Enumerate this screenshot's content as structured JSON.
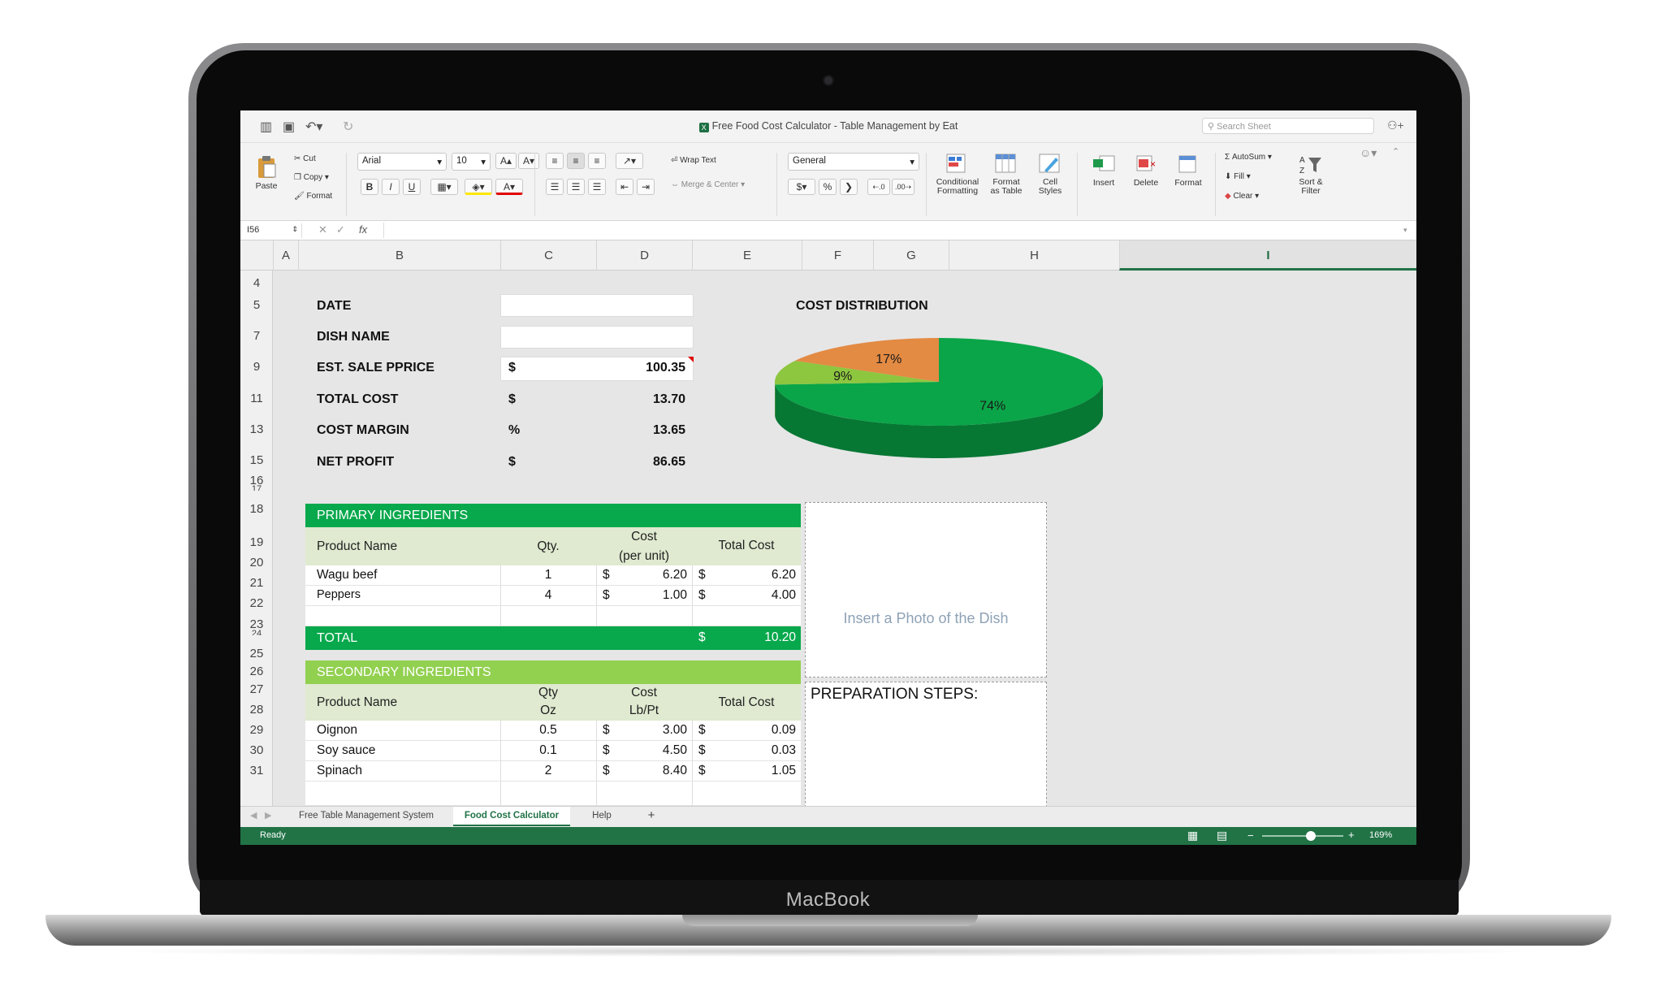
{
  "device": {
    "label": "MacBook"
  },
  "window": {
    "title": "Free Food Cost Calculator - Table Management by Eat",
    "search_placeholder": "Search Sheet"
  },
  "ribbon": {
    "paste": "Paste",
    "cut": "Cut",
    "copy": "Copy",
    "format_painter": "Format",
    "font_name": "Arial",
    "font_size": "10",
    "bold": "B",
    "italic": "I",
    "underline": "U",
    "wrap_text": "Wrap Text",
    "merge_center": "Merge & Center",
    "number_format": "General",
    "currency": "$",
    "percent": "%",
    "conditional_formatting": [
      "Conditional",
      "Formatting"
    ],
    "format_as_table": [
      "Format",
      "as Table"
    ],
    "cell_styles": [
      "Cell",
      "Styles"
    ],
    "insert": "Insert",
    "delete": "Delete",
    "format": "Format",
    "autosum": "AutoSum",
    "fill": "Fill",
    "clear": "Clear",
    "sort_filter": [
      "Sort &",
      "Filter"
    ]
  },
  "formula_bar": {
    "name_box": "I56",
    "fx": "fx"
  },
  "columns": [
    "A",
    "B",
    "C",
    "D",
    "E",
    "F",
    "G",
    "H",
    "I"
  ],
  "selected_column": "I",
  "rows": [
    "4",
    "5",
    "7",
    "9",
    "11",
    "13",
    "15",
    "16",
    "17",
    "18",
    "19",
    "20",
    "21",
    "22",
    "23",
    "24",
    "25",
    "26",
    "27",
    "28",
    "29",
    "30",
    "31"
  ],
  "summary": [
    {
      "label": "DATE",
      "currency": "",
      "value": ""
    },
    {
      "label": "DISH NAME",
      "currency": "",
      "value": ""
    },
    {
      "label": "EST. SALE PPRICE",
      "currency": "$",
      "value": "100.35"
    },
    {
      "label": "TOTAL COST",
      "currency": "$",
      "value": "13.70"
    },
    {
      "label": "COST MARGIN",
      "currency": "%",
      "value": "13.65"
    },
    {
      "label": "NET PROFIT",
      "currency": "$",
      "value": "86.65"
    }
  ],
  "chart_data": {
    "type": "pie",
    "title": "COST DISTRIBUTION",
    "labels": [
      "74%",
      "9%",
      "17%"
    ],
    "values": [
      74,
      9,
      17
    ],
    "colors": [
      "#0aa548",
      "#8dc63f",
      "#e38a43"
    ]
  },
  "primary": {
    "title": "PRIMARY INGREDIENTS",
    "headers": {
      "product": "Product Name",
      "qty": "Qty.",
      "cost_top": "Cost",
      "cost_bottom": "(per unit)",
      "total": "Total Cost"
    },
    "rows": [
      {
        "product": "Wagu beef",
        "qty": "1",
        "cur1": "$",
        "cost": "6.20",
        "cur2": "$",
        "total": "6.20"
      },
      {
        "product": "Peppers",
        "qty": "4",
        "cur1": "$",
        "cost": "1.00",
        "cur2": "$",
        "total": "4.00"
      }
    ],
    "total_label": "TOTAL",
    "total_currency": "$",
    "total_value": "10.20"
  },
  "secondary": {
    "title": "SECONDARY INGREDIENTS",
    "headers": {
      "product": "Product Name",
      "qty_top": "Qty",
      "qty_bottom": "Oz",
      "cost_top": "Cost",
      "cost_bottom": "Lb/Pt",
      "total": "Total Cost"
    },
    "rows": [
      {
        "product": "Oignon",
        "qty": "0.5",
        "cur1": "$",
        "cost": "3.00",
        "cur2": "$",
        "total": "0.09"
      },
      {
        "product": "Soy sauce",
        "qty": "0.1",
        "cur1": "$",
        "cost": "4.50",
        "cur2": "$",
        "total": "0.03"
      },
      {
        "product": "Spinach",
        "qty": "2",
        "cur1": "$",
        "cost": "8.40",
        "cur2": "$",
        "total": "1.05"
      }
    ]
  },
  "photo_placeholder": "Insert a Photo of the Dish",
  "prep_label": "PREPARATION STEPS:",
  "sheet_tabs": [
    "Free Table Management System",
    "Food Cost Calculator",
    "Help",
    "+"
  ],
  "active_tab": "Food Cost Calculator",
  "status": {
    "text": "Ready",
    "zoom": "169%",
    "zoom_minus": "−",
    "zoom_plus": "+",
    "zoom_fraction": 0.6
  }
}
